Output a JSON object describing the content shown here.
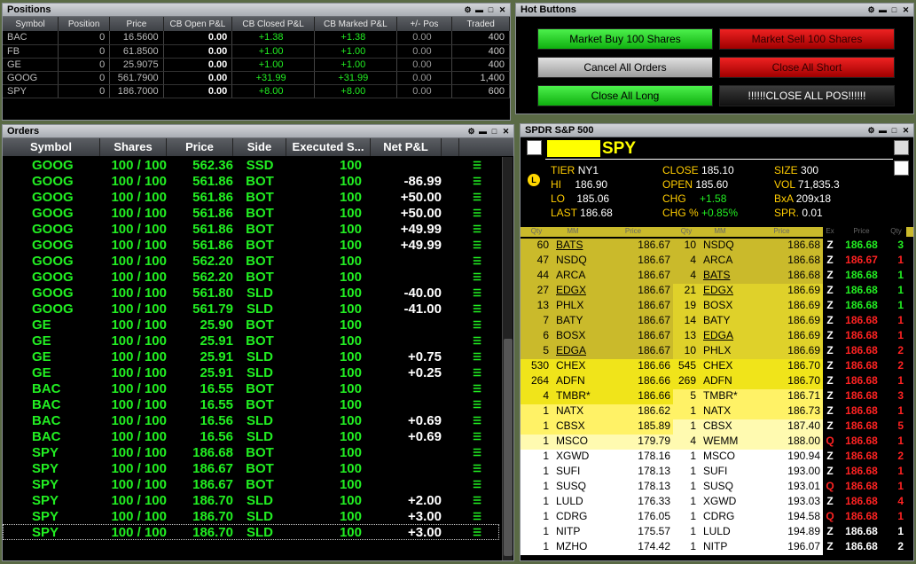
{
  "positions": {
    "title": "Positions",
    "columns": [
      "Symbol",
      "Position",
      "Price",
      "CB Open P&L",
      "CB Closed P&L",
      "CB Marked P&L",
      "+/- Pos",
      "Traded"
    ],
    "rows": [
      [
        "BAC",
        "0",
        "16.5600",
        "0.00",
        "+1.38",
        "+1.38",
        "0.00",
        "400"
      ],
      [
        "FB",
        "0",
        "61.8500",
        "0.00",
        "+1.00",
        "+1.00",
        "0.00",
        "400"
      ],
      [
        "GE",
        "0",
        "25.9075",
        "0.00",
        "+1.00",
        "+1.00",
        "0.00",
        "400"
      ],
      [
        "GOOG",
        "0",
        "561.7900",
        "0.00",
        "+31.99",
        "+31.99",
        "0.00",
        "1,400"
      ],
      [
        "SPY",
        "0",
        "186.7000",
        "0.00",
        "+8.00",
        "+8.00",
        "0.00",
        "600"
      ]
    ]
  },
  "hot_buttons": {
    "title": "Hot Buttons",
    "buttons": [
      {
        "label": "Market Buy 100 Shares",
        "style": "green"
      },
      {
        "label": "Market Sell 100 Shares",
        "style": "red"
      },
      {
        "label": "Cancel All Orders",
        "style": "gray"
      },
      {
        "label": "Close All Short",
        "style": "red"
      },
      {
        "label": "Close All Long",
        "style": "green"
      },
      {
        "label": "!!!!!!CLOSE ALL POS!!!!!!",
        "style": "dark"
      }
    ]
  },
  "orders": {
    "title": "Orders",
    "columns": [
      "Symbol",
      "Shares",
      "Price",
      "Side",
      "Executed S...",
      "Net P&L"
    ],
    "rows": [
      [
        "GOOG",
        "100 / 100",
        "562.36",
        "SSD",
        "100",
        ""
      ],
      [
        "GOOG",
        "100 / 100",
        "561.86",
        "BOT",
        "100",
        "-86.99"
      ],
      [
        "GOOG",
        "100 / 100",
        "561.86",
        "BOT",
        "100",
        "+50.00"
      ],
      [
        "GOOG",
        "100 / 100",
        "561.86",
        "BOT",
        "100",
        "+50.00"
      ],
      [
        "GOOG",
        "100 / 100",
        "561.86",
        "BOT",
        "100",
        "+49.99"
      ],
      [
        "GOOG",
        "100 / 100",
        "561.86",
        "BOT",
        "100",
        "+49.99"
      ],
      [
        "GOOG",
        "100 / 100",
        "562.20",
        "BOT",
        "100",
        ""
      ],
      [
        "GOOG",
        "100 / 100",
        "562.20",
        "BOT",
        "100",
        ""
      ],
      [
        "GOOG",
        "100 / 100",
        "561.80",
        "SLD",
        "100",
        "-40.00"
      ],
      [
        "GOOG",
        "100 / 100",
        "561.79",
        "SLD",
        "100",
        "-41.00"
      ],
      [
        "GE",
        "100 / 100",
        "25.90",
        "BOT",
        "100",
        ""
      ],
      [
        "GE",
        "100 / 100",
        "25.91",
        "BOT",
        "100",
        ""
      ],
      [
        "GE",
        "100 / 100",
        "25.91",
        "SLD",
        "100",
        "+0.75"
      ],
      [
        "GE",
        "100 / 100",
        "25.91",
        "SLD",
        "100",
        "+0.25"
      ],
      [
        "BAC",
        "100 / 100",
        "16.55",
        "BOT",
        "100",
        ""
      ],
      [
        "BAC",
        "100 / 100",
        "16.55",
        "BOT",
        "100",
        ""
      ],
      [
        "BAC",
        "100 / 100",
        "16.56",
        "SLD",
        "100",
        "+0.69"
      ],
      [
        "BAC",
        "100 / 100",
        "16.56",
        "SLD",
        "100",
        "+0.69"
      ],
      [
        "SPY",
        "100 / 100",
        "186.68",
        "BOT",
        "100",
        ""
      ],
      [
        "SPY",
        "100 / 100",
        "186.67",
        "BOT",
        "100",
        ""
      ],
      [
        "SPY",
        "100 / 100",
        "186.67",
        "BOT",
        "100",
        ""
      ],
      [
        "SPY",
        "100 / 100",
        "186.70",
        "SLD",
        "100",
        "+2.00"
      ],
      [
        "SPY",
        "100 / 100",
        "186.70",
        "SLD",
        "100",
        "+3.00"
      ],
      [
        "SPY",
        "100 / 100",
        "186.70",
        "SLD",
        "100",
        "+3.00"
      ]
    ]
  },
  "level2": {
    "title": "SPDR S&P 500",
    "symbol": "SPY",
    "quote": {
      "tier_label": "TIER",
      "tier": "NY1",
      "hi_label": "HI",
      "hi": "186.90",
      "lo_label": "LO",
      "lo": "185.06",
      "last_label": "LAST",
      "last": "186.68",
      "close_label": "CLOSE",
      "close": "185.10",
      "open_label": "OPEN",
      "open": "185.60",
      "chg_label": "CHG",
      "chg": "+1.58",
      "chgp_label": "CHG %",
      "chgp": "+0.85%",
      "size_label": "SIZE",
      "size": "300",
      "vol_label": "VOL",
      "vol": "71,835.3",
      "bxa_label": "BxA",
      "bxa": "209x18",
      "spr_label": "SPR.",
      "spr": "0.01"
    },
    "col_headers": [
      "Qty",
      "MM",
      "Price",
      "Qty",
      "MM",
      "Price",
      "Ex",
      "Price",
      "Qty"
    ],
    "book": [
      {
        "bq": "60",
        "bm": "BATS",
        "bp": "186.67",
        "aq": "10",
        "am": "NSDQ",
        "ap": "186.68",
        "bu": true,
        "au": false,
        "bb": 0,
        "ab": 0,
        "te": "Z",
        "tp": "186.68",
        "tq": "3",
        "tc": "g"
      },
      {
        "bq": "47",
        "bm": "NSDQ",
        "bp": "186.67",
        "aq": "4",
        "am": "ARCA",
        "ap": "186.68",
        "bu": false,
        "au": false,
        "bb": 0,
        "ab": 0,
        "te": "Z",
        "tp": "186.67",
        "tq": "1",
        "tc": "r"
      },
      {
        "bq": "44",
        "bm": "ARCA",
        "bp": "186.67",
        "aq": "4",
        "am": "BATS",
        "ap": "186.68",
        "bu": false,
        "au": true,
        "bb": 0,
        "ab": 0,
        "te": "Z",
        "tp": "186.68",
        "tq": "1",
        "tc": "g"
      },
      {
        "bq": "27",
        "bm": "EDGX",
        "bp": "186.67",
        "aq": "21",
        "am": "EDGX",
        "ap": "186.69",
        "bu": true,
        "au": true,
        "bb": 0,
        "ab": 1,
        "te": "Z",
        "tp": "186.68",
        "tq": "1",
        "tc": "g"
      },
      {
        "bq": "13",
        "bm": "PHLX",
        "bp": "186.67",
        "aq": "19",
        "am": "BOSX",
        "ap": "186.69",
        "bu": false,
        "au": false,
        "bb": 0,
        "ab": 1,
        "te": "Z",
        "tp": "186.68",
        "tq": "1",
        "tc": "g"
      },
      {
        "bq": "7",
        "bm": "BATY",
        "bp": "186.67",
        "aq": "14",
        "am": "BATY",
        "ap": "186.69",
        "bu": false,
        "au": false,
        "bb": 0,
        "ab": 1,
        "te": "Z",
        "tp": "186.68",
        "tq": "1",
        "tc": "r"
      },
      {
        "bq": "6",
        "bm": "BOSX",
        "bp": "186.67",
        "aq": "13",
        "am": "EDGA",
        "ap": "186.69",
        "bu": false,
        "au": true,
        "bb": 0,
        "ab": 1,
        "te": "Z",
        "tp": "186.68",
        "tq": "1",
        "tc": "r"
      },
      {
        "bq": "5",
        "bm": "EDGA",
        "bp": "186.67",
        "aq": "10",
        "am": "PHLX",
        "ap": "186.69",
        "bu": true,
        "au": false,
        "bb": 0,
        "ab": 1,
        "te": "Z",
        "tp": "186.68",
        "tq": "2",
        "tc": "r"
      },
      {
        "bq": "530",
        "bm": "CHEX",
        "bp": "186.66",
        "aq": "545",
        "am": "CHEX",
        "ap": "186.70",
        "bu": false,
        "au": false,
        "bb": 2,
        "ab": 2,
        "te": "Z",
        "tp": "186.68",
        "tq": "2",
        "tc": "r"
      },
      {
        "bq": "264",
        "bm": "ADFN",
        "bp": "186.66",
        "aq": "269",
        "am": "ADFN",
        "ap": "186.70",
        "bu": false,
        "au": false,
        "bb": 2,
        "ab": 2,
        "te": "Z",
        "tp": "186.68",
        "tq": "1",
        "tc": "r"
      },
      {
        "bq": "4",
        "bm": "TMBR*",
        "bp": "186.66",
        "aq": "5",
        "am": "TMBR*",
        "ap": "186.71",
        "bu": false,
        "au": false,
        "bb": 2,
        "ab": 3,
        "te": "Z",
        "tp": "186.68",
        "tq": "3",
        "tc": "r"
      },
      {
        "bq": "1",
        "bm": "NATX",
        "bp": "186.62",
        "aq": "1",
        "am": "NATX",
        "ap": "186.73",
        "bu": false,
        "au": false,
        "bb": 3,
        "ab": 3,
        "te": "Z",
        "tp": "186.68",
        "tq": "1",
        "tc": "r"
      },
      {
        "bq": "1",
        "bm": "CBSX",
        "bp": "185.89",
        "aq": "1",
        "am": "CBSX",
        "ap": "187.40",
        "bu": false,
        "au": false,
        "bb": 3,
        "ab": 4,
        "te": "Z",
        "tp": "186.68",
        "tq": "5",
        "tc": "r"
      },
      {
        "bq": "1",
        "bm": "MSCO",
        "bp": "179.79",
        "aq": "4",
        "am": "WEMM",
        "ap": "188.00",
        "bu": false,
        "au": false,
        "bb": 4,
        "ab": 4,
        "te": "Q",
        "tp": "186.68",
        "tq": "1",
        "tc": "r"
      },
      {
        "bq": "1",
        "bm": "XGWD",
        "bp": "178.16",
        "aq": "1",
        "am": "MSCO",
        "ap": "190.94",
        "bu": false,
        "au": false,
        "bb": 5,
        "ab": 5,
        "te": "Z",
        "tp": "186.68",
        "tq": "2",
        "tc": "r"
      },
      {
        "bq": "1",
        "bm": "SUFI",
        "bp": "178.13",
        "aq": "1",
        "am": "SUFI",
        "ap": "193.00",
        "bu": false,
        "au": false,
        "bb": 5,
        "ab": 5,
        "te": "Z",
        "tp": "186.68",
        "tq": "1",
        "tc": "r"
      },
      {
        "bq": "1",
        "bm": "SUSQ",
        "bp": "178.13",
        "aq": "1",
        "am": "SUSQ",
        "ap": "193.01",
        "bu": false,
        "au": false,
        "bb": 5,
        "ab": 5,
        "te": "Q",
        "tp": "186.68",
        "tq": "1",
        "tc": "r"
      },
      {
        "bq": "1",
        "bm": "LULD",
        "bp": "176.33",
        "aq": "1",
        "am": "XGWD",
        "ap": "193.03",
        "bu": false,
        "au": false,
        "bb": 5,
        "ab": 5,
        "te": "Z",
        "tp": "186.68",
        "tq": "4",
        "tc": "r"
      },
      {
        "bq": "1",
        "bm": "CDRG",
        "bp": "176.05",
        "aq": "1",
        "am": "CDRG",
        "ap": "194.58",
        "bu": false,
        "au": false,
        "bb": 5,
        "ab": 5,
        "te": "Q",
        "tp": "186.68",
        "tq": "1",
        "tc": "r"
      },
      {
        "bq": "1",
        "bm": "NITP",
        "bp": "175.57",
        "aq": "1",
        "am": "LULD",
        "ap": "194.89",
        "bu": false,
        "au": false,
        "bb": 5,
        "ab": 5,
        "te": "Z",
        "tp": "186.68",
        "tq": "1",
        "tc": "w"
      },
      {
        "bq": "1",
        "bm": "MZHO",
        "bp": "174.42",
        "aq": "1",
        "am": "NITP",
        "ap": "196.07",
        "bu": false,
        "au": false,
        "bb": 5,
        "ab": 5,
        "te": "Z",
        "tp": "186.68",
        "tq": "2",
        "tc": "w"
      }
    ]
  },
  "colors": {
    "green": "#22ee22",
    "red": "#ff2222",
    "yellow": "#ffff00"
  }
}
